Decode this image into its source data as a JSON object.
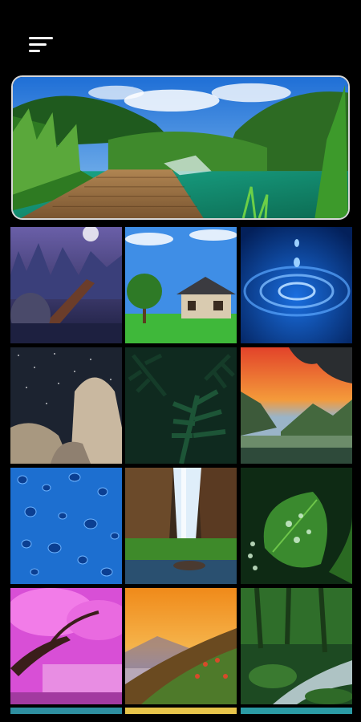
{
  "app": {
    "background_color": "#000000",
    "menu_icon": "hamburger-sort-icon",
    "hero": {
      "name": "wooden-boardwalk-waterfall-lake"
    },
    "wallpapers": [
      {
        "name": "fantasy-bridge-city"
      },
      {
        "name": "house-on-green-field"
      },
      {
        "name": "water-drop-ripples"
      },
      {
        "name": "rock-under-milky-way"
      },
      {
        "name": "fern-leaves"
      },
      {
        "name": "sunset-mountain-lake"
      },
      {
        "name": "blue-raindrops"
      },
      {
        "name": "forest-waterfall"
      },
      {
        "name": "leaf-with-dew-drops"
      },
      {
        "name": "pink-blossom-tree"
      },
      {
        "name": "sunset-mountain-slope"
      },
      {
        "name": "green-forest-stream"
      }
    ],
    "next_row_colors": [
      "#2e8fa0",
      "#e7c44a",
      "#2b9ba5"
    ]
  }
}
